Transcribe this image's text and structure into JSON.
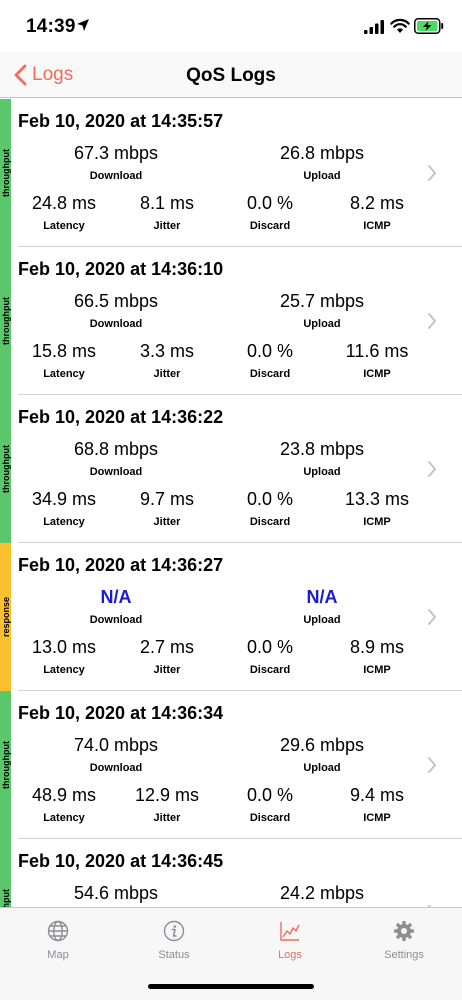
{
  "status_bar": {
    "time": "14:39",
    "battery_color": "#4cd964"
  },
  "nav": {
    "back_label": "Logs",
    "title": "QoS Logs",
    "accent": "#f36b5f"
  },
  "strip_colors": {
    "throughput": "#5ac86a",
    "response": "#fbc02d"
  },
  "entries": [
    {
      "type": "throughput",
      "date": "Feb 10, 2020 at 14:35:57",
      "download": "67.3 mbps",
      "download_label": "Download",
      "upload": "26.8 mbps",
      "upload_label": "Upload",
      "latency": "24.8 ms",
      "latency_label": "Latency",
      "jitter": "8.1 ms",
      "jitter_label": "Jitter",
      "discard": "0.0 %",
      "discard_label": "Discard",
      "icmp": "8.2 ms",
      "icmp_label": "ICMP"
    },
    {
      "type": "throughput",
      "date": "Feb 10, 2020 at 14:36:10",
      "download": "66.5 mbps",
      "download_label": "Download",
      "upload": "25.7 mbps",
      "upload_label": "Upload",
      "latency": "15.8 ms",
      "latency_label": "Latency",
      "jitter": "3.3 ms",
      "jitter_label": "Jitter",
      "discard": "0.0 %",
      "discard_label": "Discard",
      "icmp": "11.6 ms",
      "icmp_label": "ICMP"
    },
    {
      "type": "throughput",
      "date": "Feb 10, 2020 at 14:36:22",
      "download": "68.8 mbps",
      "download_label": "Download",
      "upload": "23.8 mbps",
      "upload_label": "Upload",
      "latency": "34.9 ms",
      "latency_label": "Latency",
      "jitter": "9.7 ms",
      "jitter_label": "Jitter",
      "discard": "0.0 %",
      "discard_label": "Discard",
      "icmp": "13.3 ms",
      "icmp_label": "ICMP"
    },
    {
      "type": "response",
      "date": "Feb 10, 2020 at 14:36:27",
      "download": "N/A",
      "download_label": "Download",
      "upload": "N/A",
      "upload_label": "Upload",
      "latency": "13.0 ms",
      "latency_label": "Latency",
      "jitter": "2.7 ms",
      "jitter_label": "Jitter",
      "discard": "0.0 %",
      "discard_label": "Discard",
      "icmp": "8.9 ms",
      "icmp_label": "ICMP"
    },
    {
      "type": "throughput",
      "date": "Feb 10, 2020 at 14:36:34",
      "download": "74.0 mbps",
      "download_label": "Download",
      "upload": "29.6 mbps",
      "upload_label": "Upload",
      "latency": "48.9 ms",
      "latency_label": "Latency",
      "jitter": "12.9 ms",
      "jitter_label": "Jitter",
      "discard": "0.0 %",
      "discard_label": "Discard",
      "icmp": "9.4 ms",
      "icmp_label": "ICMP"
    },
    {
      "type": "throughput",
      "date": "Feb 10, 2020 at 14:36:45",
      "download": "54.6 mbps",
      "download_label": "Download",
      "upload": "24.2 mbps",
      "upload_label": "Upload"
    }
  ],
  "tabs": [
    {
      "label": "Map",
      "icon": "globe-icon",
      "active": false
    },
    {
      "label": "Status",
      "icon": "info-icon",
      "active": false
    },
    {
      "label": "Logs",
      "icon": "chart-icon",
      "active": true
    },
    {
      "label": "Settings",
      "icon": "gear-icon",
      "active": false
    }
  ]
}
